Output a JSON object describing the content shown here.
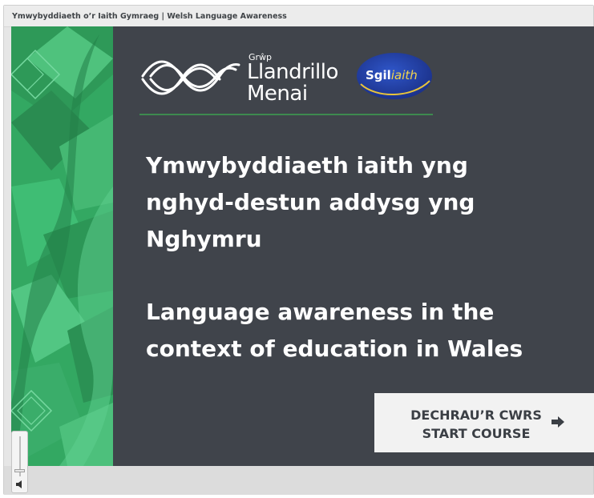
{
  "window": {
    "title": "Ymwybyddiaeth o’r Iaith Gymraeg | Welsh Language Awareness"
  },
  "logo": {
    "grwp": "Grŵp",
    "name_line1": "Llandrillo",
    "name_line2": "Menai",
    "badge_part1": "Sgil",
    "badge_part2": "iaith"
  },
  "slide": {
    "heading_welsh": "Ymwybyddiaeth iaith yng nghyd-destun addysg yng Nghymru",
    "heading_english": "Language awareness in the context of education in Wales"
  },
  "start_button": {
    "label_welsh": "DECHRAU’R CWRS",
    "label_english": "START COURSE",
    "icon": "arrow-right-icon"
  },
  "player": {
    "volume_icon": "speaker-icon",
    "volume_level": 0.1
  },
  "colors": {
    "slide_background": "#40444b",
    "accent_green": "#3d8a4f",
    "pattern_green": "#3cb46a",
    "badge_blue": "#1f3a9e",
    "button_background": "#f2f2f2"
  }
}
